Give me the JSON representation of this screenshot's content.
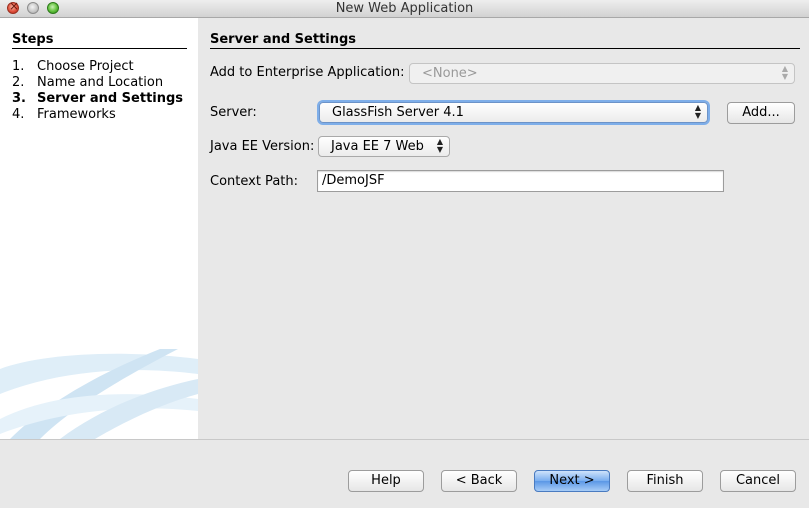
{
  "window": {
    "title": "New Web Application"
  },
  "steps": {
    "heading": "Steps",
    "items": [
      {
        "num": "1.",
        "label": "Choose Project",
        "current": false
      },
      {
        "num": "2.",
        "label": "Name and Location",
        "current": false
      },
      {
        "num": "3.",
        "label": "Server and Settings",
        "current": true
      },
      {
        "num": "4.",
        "label": "Frameworks",
        "current": false
      }
    ]
  },
  "panel": {
    "heading": "Server and Settings",
    "enterprise": {
      "label": "Add to Enterprise Application:",
      "value": "<None>",
      "enabled": false
    },
    "server": {
      "label": "Server:",
      "value": "GlassFish Server 4.1",
      "add_label": "Add..."
    },
    "javaee": {
      "label": "Java EE Version:",
      "value": "Java EE 7 Web"
    },
    "context": {
      "label": "Context Path:",
      "value": "/DemoJSF"
    }
  },
  "buttons": {
    "help": "Help",
    "back": "< Back",
    "next": "Next >",
    "finish": "Finish",
    "cancel": "Cancel"
  },
  "colors": {
    "primary_button": "#6aa3ea",
    "focus_ring": "#7eaee9"
  }
}
